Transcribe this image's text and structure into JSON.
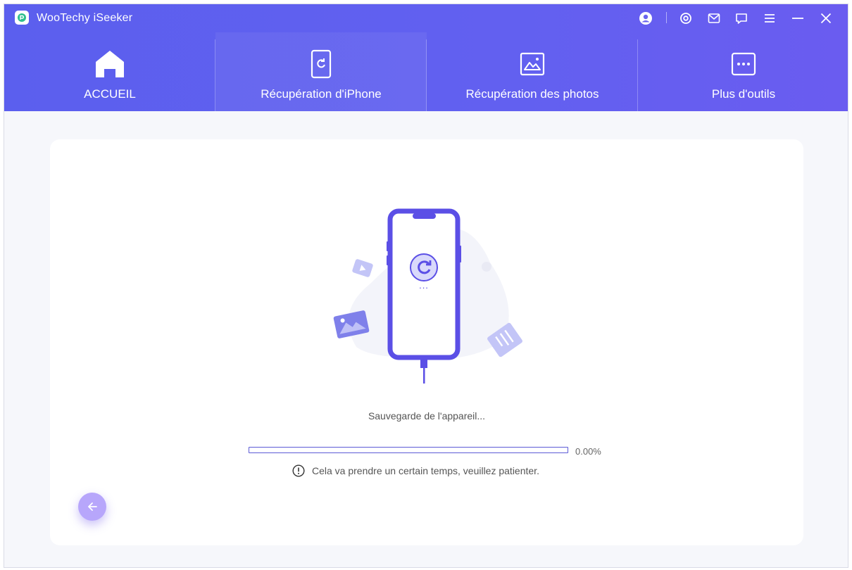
{
  "app": {
    "title": "WooTechy iSeeker",
    "logo_icon": "iseeker-logo"
  },
  "titlebar": {
    "buttons": [
      {
        "name": "account-icon"
      },
      {
        "name": "settings-icon"
      },
      {
        "name": "mail-icon"
      },
      {
        "name": "feedback-icon"
      },
      {
        "name": "menu-icon"
      },
      {
        "name": "minimize-icon"
      },
      {
        "name": "close-icon"
      }
    ]
  },
  "tabs": [
    {
      "label": "ACCUEIL",
      "icon": "home-icon",
      "active": false
    },
    {
      "label": "Récupération d'iPhone",
      "icon": "iphone-recovery-icon",
      "active": true
    },
    {
      "label": "Récupération des photos",
      "icon": "photo-recovery-icon",
      "active": false
    },
    {
      "label": "Plus d'outils",
      "icon": "more-tools-icon",
      "active": false
    }
  ],
  "main": {
    "status": "Sauvegarde de l'appareil...",
    "progress": {
      "value": 0.0,
      "label": "0.00%"
    },
    "notice": "Cela va prendre un certain temps, veuillez patienter.",
    "phone_dots": "..."
  },
  "colors": {
    "header_start": "#5b5fee",
    "header_end": "#6a5cf0",
    "accent": "#5c5bd6",
    "back_button": "#b7a6fb"
  }
}
